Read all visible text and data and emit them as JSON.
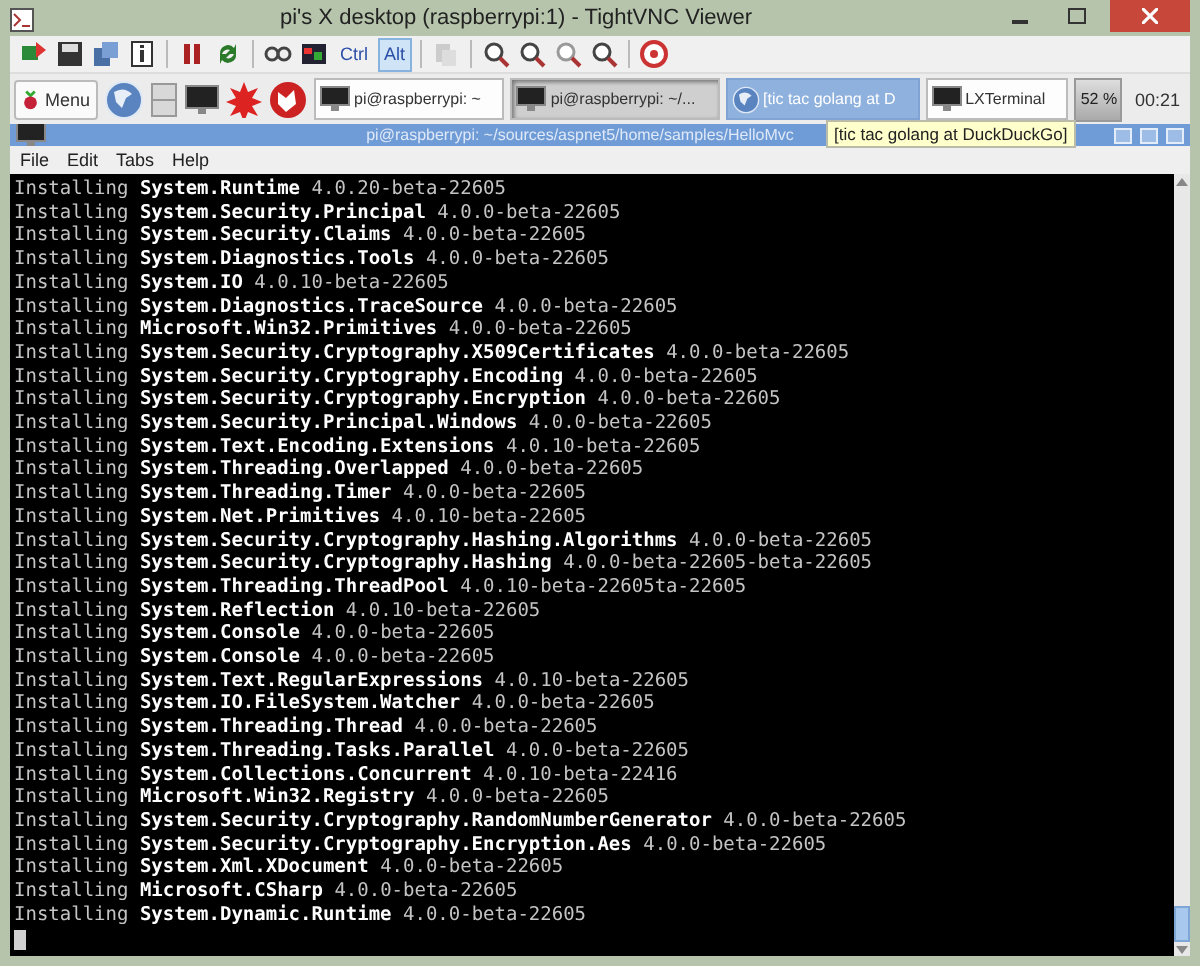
{
  "window": {
    "title": "pi's X desktop (raspberrypi:1) - TightVNC Viewer"
  },
  "toolbar": {
    "keys": [
      {
        "label": "Ctrl",
        "pressed": false
      },
      {
        "label": "Alt",
        "pressed": true
      }
    ]
  },
  "taskbar": {
    "menu": "Menu",
    "tasks": [
      {
        "label": "pi@raspberrypi: ~",
        "kind": "terminal",
        "selected": false,
        "hovered": false
      },
      {
        "label": "pi@raspberrypi: ~/...",
        "kind": "terminal",
        "selected": true,
        "hovered": false
      },
      {
        "label": "[tic tac golang at D",
        "kind": "browser",
        "selected": false,
        "hovered": true
      },
      {
        "label": "LXTerminal",
        "kind": "terminal",
        "selected": false,
        "hovered": false
      }
    ],
    "cpu": "52 %",
    "clock": "00:21",
    "tooltip": "[tic tac golang at DuckDuckGo]"
  },
  "terminal": {
    "title": "pi@raspberrypi: ~/sources/aspnet5/home/samples/HelloMvc",
    "menu": [
      "File",
      "Edit",
      "Tabs",
      "Help"
    ],
    "lines": [
      {
        "verb": "Installing",
        "package": "System.Runtime",
        "version": "4.0.20-beta-22605"
      },
      {
        "verb": "Installing",
        "package": "System.Security.Principal",
        "version": "4.0.0-beta-22605"
      },
      {
        "verb": "Installing",
        "package": "System.Security.Claims",
        "version": "4.0.0-beta-22605"
      },
      {
        "verb": "Installing",
        "package": "System.Diagnostics.Tools",
        "version": "4.0.0-beta-22605"
      },
      {
        "verb": "Installing",
        "package": "System.IO",
        "version": "4.0.10-beta-22605"
      },
      {
        "verb": "Installing",
        "package": "System.Diagnostics.TraceSource",
        "version": "4.0.0-beta-22605"
      },
      {
        "verb": "Installing",
        "package": "Microsoft.Win32.Primitives",
        "version": "4.0.0-beta-22605"
      },
      {
        "verb": "Installing",
        "package": "System.Security.Cryptography.X509Certificates",
        "version": "4.0.0-beta-22605"
      },
      {
        "verb": "Installing",
        "package": "System.Security.Cryptography.Encoding",
        "version": "4.0.0-beta-22605"
      },
      {
        "verb": "Installing",
        "package": "System.Security.Cryptography.Encryption",
        "version": "4.0.0-beta-22605"
      },
      {
        "verb": "Installing",
        "package": "System.Security.Principal.Windows",
        "version": "4.0.0-beta-22605"
      },
      {
        "verb": "Installing",
        "package": "System.Text.Encoding.Extensions",
        "version": "4.0.10-beta-22605"
      },
      {
        "verb": "Installing",
        "package": "System.Threading.Overlapped",
        "version": "4.0.0-beta-22605"
      },
      {
        "verb": "Installing",
        "package": "System.Threading.Timer",
        "version": "4.0.0-beta-22605"
      },
      {
        "verb": "Installing",
        "package": "System.Net.Primitives",
        "version": "4.0.10-beta-22605"
      },
      {
        "verb": "Installing",
        "package": "System.Security.Cryptography.Hashing.Algorithms",
        "version": "4.0.0-beta-22605"
      },
      {
        "verb": "Installing",
        "package": "System.Security.Cryptography.Hashing",
        "version": "4.0.0-beta-22605-beta-22605"
      },
      {
        "verb": "Installing",
        "package": "System.Threading.ThreadPool",
        "version": "4.0.10-beta-22605ta-22605"
      },
      {
        "verb": "Installing",
        "package": "System.Reflection",
        "version": "4.0.10-beta-22605"
      },
      {
        "verb": "Installing",
        "package": "System.Console",
        "version": "4.0.0-beta-22605"
      },
      {
        "verb": "Installing",
        "package": "System.Console",
        "version": "4.0.0-beta-22605"
      },
      {
        "verb": "Installing",
        "package": "System.Text.RegularExpressions",
        "version": "4.0.10-beta-22605"
      },
      {
        "verb": "Installing",
        "package": "System.IO.FileSystem.Watcher",
        "version": "4.0.0-beta-22605"
      },
      {
        "verb": "Installing",
        "package": "System.Threading.Thread",
        "version": "4.0.0-beta-22605"
      },
      {
        "verb": "Installing",
        "package": "System.Threading.Tasks.Parallel",
        "version": "4.0.0-beta-22605"
      },
      {
        "verb": "Installing",
        "package": "System.Collections.Concurrent",
        "version": "4.0.10-beta-22416"
      },
      {
        "verb": "Installing",
        "package": "Microsoft.Win32.Registry",
        "version": "4.0.0-beta-22605"
      },
      {
        "verb": "Installing",
        "package": "System.Security.Cryptography.RandomNumberGenerator",
        "version": "4.0.0-beta-22605"
      },
      {
        "verb": "Installing",
        "package": "System.Security.Cryptography.Encryption.Aes",
        "version": "4.0.0-beta-22605"
      },
      {
        "verb": "Installing",
        "package": "System.Xml.XDocument",
        "version": "4.0.0-beta-22605"
      },
      {
        "verb": "Installing",
        "package": "Microsoft.CSharp",
        "version": "4.0.0-beta-22605"
      },
      {
        "verb": "Installing",
        "package": "System.Dynamic.Runtime",
        "version": "4.0.0-beta-22605"
      }
    ]
  }
}
